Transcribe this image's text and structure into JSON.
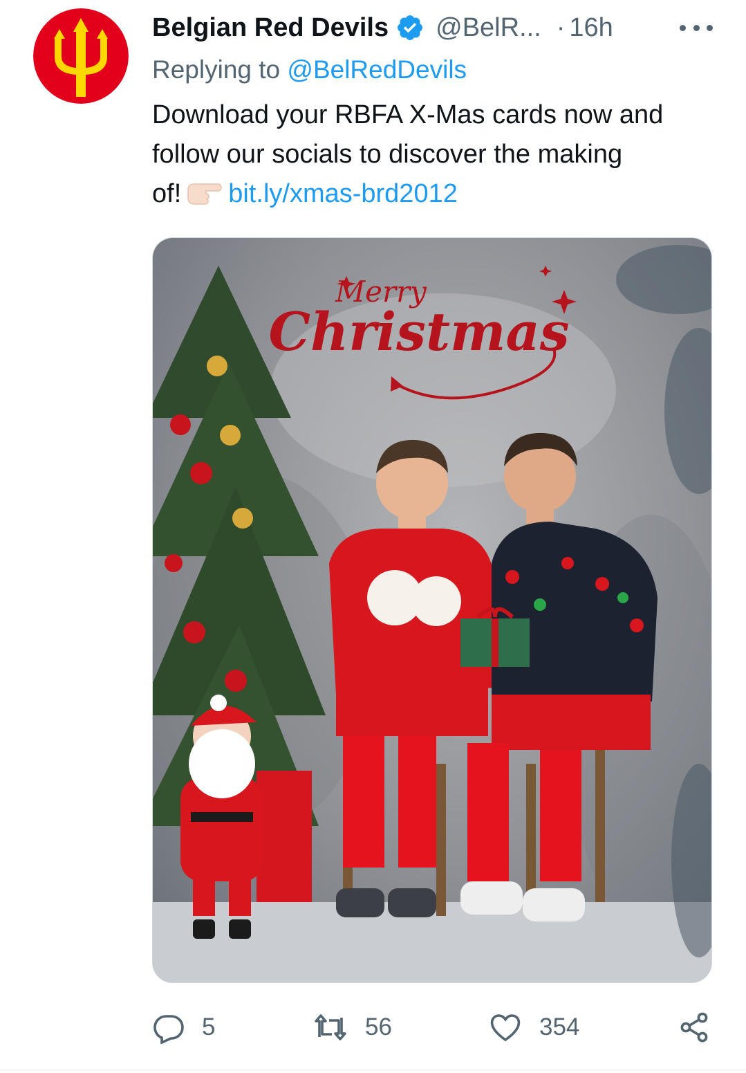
{
  "tweet": {
    "author_name": "Belgian Red Devils",
    "handle": "@BelR...",
    "separator": "·",
    "time": "16h",
    "replying_prefix": "Replying to",
    "replying_handle": "@BelRedDevils",
    "text_line1": "Download your RBFA X-Mas cards now and",
    "text_line2": "follow our socials to discover the making",
    "text_line3": "of!",
    "link": "bit.ly/xmas-brd2012"
  },
  "media": {
    "overlay_title_top": "Merry",
    "overlay_title_main": "Christmas"
  },
  "actions": {
    "reply_count": "5",
    "retweet_count": "56",
    "like_count": "354"
  },
  "icons": {
    "avatar": "trident-logo",
    "verified": "verified-badge-icon",
    "more": "more-dots-icon",
    "reply": "reply-icon",
    "retweet": "retweet-icon",
    "like": "heart-icon",
    "share": "share-icon"
  },
  "colors": {
    "link": "#1d9bf0",
    "secondary_text": "#536471",
    "avatar_red": "#e3001b",
    "avatar_yellow": "#ffd800"
  }
}
